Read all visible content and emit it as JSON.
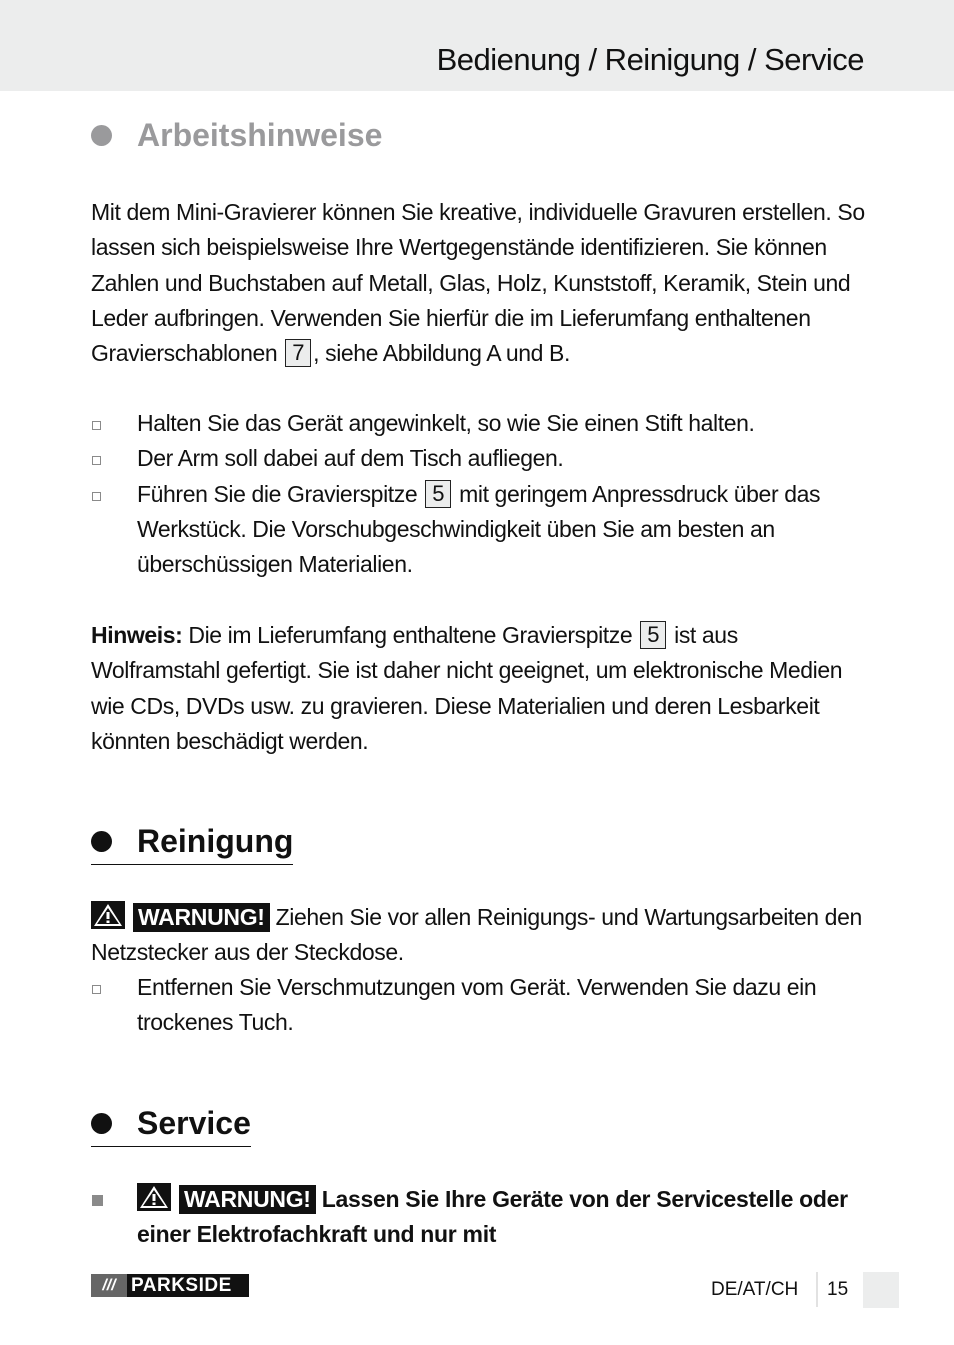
{
  "header": {
    "title": "Bedienung / Reinigung / Service"
  },
  "arbeitshinweise": {
    "heading": "Arbeitshinweise",
    "intro_before_ref": "Mit dem Mini-Gravierer können Sie kreative, individuelle Gravuren erstellen. So lassen sich beispielsweise Ihre Wertgegenstände identifizieren. Sie können Zahlen und Buchstaben auf Metall, Glas, Holz, Kunststoff, Keramik, Stein und Leder aufbringen. Verwenden Sie hierfür die im Lieferumfang enthaltenen Gravierschablonen",
    "intro_ref": "7",
    "intro_after_ref": ", siehe Abbildung A und B.",
    "bullets": [
      {
        "text": "Halten Sie das Gerät angewinkelt, so wie Sie einen Stift halten."
      },
      {
        "text": "Der Arm soll dabei auf dem Tisch aufliegen."
      },
      {
        "before": "Führen Sie die Gravierspitze",
        "ref": "5",
        "after": "mit geringem Anpressdruck über das Werkstück. Die Vorschubgeschwindigkeit üben Sie am besten an überschüssigen Materialien."
      }
    ],
    "note": {
      "label": "Hinweis:",
      "before_ref": "Die im Lieferumfang enthaltene Gravierspitze",
      "ref": "5",
      "after_ref": "ist aus Wolframstahl gefertigt. Sie ist daher nicht geeignet, um elektronische Medien wie CDs, DVDs usw. zu gravieren. Diese Materialien und deren Lesbarkeit könnten beschädigt werden."
    }
  },
  "reinigung": {
    "heading": "Reinigung",
    "warning_label": "WARNUNG!",
    "warning_text": "Ziehen Sie vor allen Reinigungs- und Wartungsarbeiten den Netzstecker aus der Steckdose.",
    "bullets": [
      {
        "text": "Entfernen Sie Verschmutzungen vom Gerät. Verwenden Sie dazu ein trockenes Tuch."
      }
    ]
  },
  "service": {
    "heading": "Service",
    "warning_label": "WARNUNG!",
    "warning_text": "Lassen Sie Ihre Geräte von der Servicestelle oder einer Elektrofachkraft und nur mit"
  },
  "footer": {
    "logo_slashes": "///",
    "logo_brand": "PARKSIDE",
    "language": "DE/AT/CH",
    "page_number": "15"
  },
  "colors": {
    "header_band": "#eceded",
    "heading_grey": "#9a9a9c",
    "text": "#111111"
  }
}
